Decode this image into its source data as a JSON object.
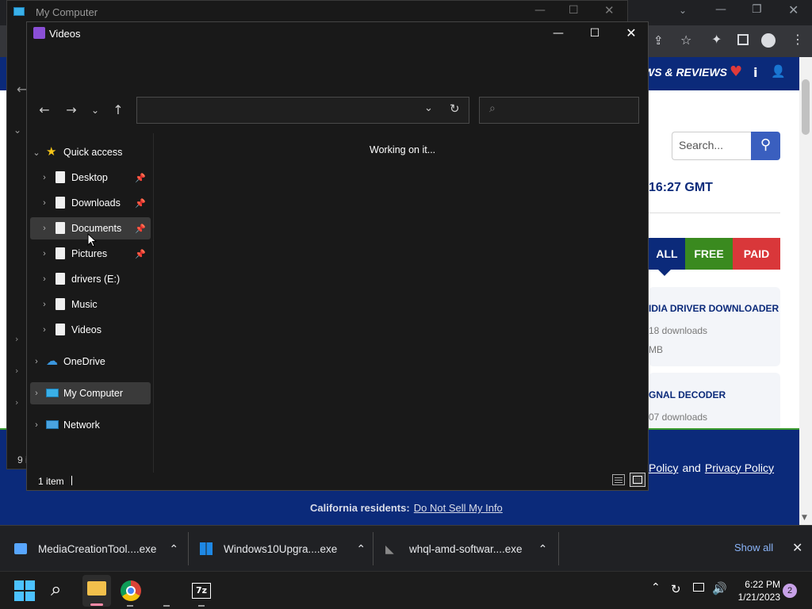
{
  "my_computer_window": {
    "title": "My Computer",
    "status_partial": "9 i"
  },
  "videos_window": {
    "title": "Videos",
    "address_value": "",
    "search_placeholder": "",
    "working_text": "Working on it...",
    "status_items": "1 item",
    "sidebar": {
      "quick_access": "Quick access",
      "items": [
        {
          "label": "Desktop",
          "pinned": true
        },
        {
          "label": "Downloads",
          "pinned": true
        },
        {
          "label": "Documents",
          "pinned": true
        },
        {
          "label": "Pictures",
          "pinned": true
        },
        {
          "label": "drivers (E:)",
          "pinned": false
        },
        {
          "label": "Music",
          "pinned": false
        },
        {
          "label": "Videos",
          "pinned": false
        }
      ],
      "onedrive": "OneDrive",
      "my_computer": "My Computer",
      "network": "Network"
    }
  },
  "web_page": {
    "nav_text": "WS & REVIEWS",
    "search_placeholder": "Search...",
    "time_text": "16:27 GMT",
    "tabs": [
      "ALL",
      "FREE",
      "PAID"
    ],
    "list": [
      {
        "title": "IDIA DRIVER DOWNLOADER",
        "downloads": "18 downloads",
        "size": "MB"
      },
      {
        "title": "GNAL DECODER",
        "downloads": "07 downloads"
      }
    ],
    "footer_policy_link": "Policy",
    "footer_and": "and",
    "footer_privacy_link": "Privacy Policy",
    "footer_ca_label": "California residents:",
    "footer_ca_link": "Do Not Sell My Info"
  },
  "download_bar": {
    "items": [
      {
        "name": "MediaCreationTool....exe"
      },
      {
        "name": "Windows10Upgra....exe"
      },
      {
        "name": "whql-amd-softwar....exe"
      }
    ],
    "show_all": "Show all"
  },
  "taskbar": {
    "time": "6:22 PM",
    "date": "1/21/2023",
    "notification_count": "2"
  },
  "colors": {
    "site_navy": "#0b2a7a",
    "tab_all": "#0b2a7a",
    "tab_free": "#3a8a1f",
    "tab_paid": "#d9373a",
    "search_button": "#3a5fbf"
  }
}
